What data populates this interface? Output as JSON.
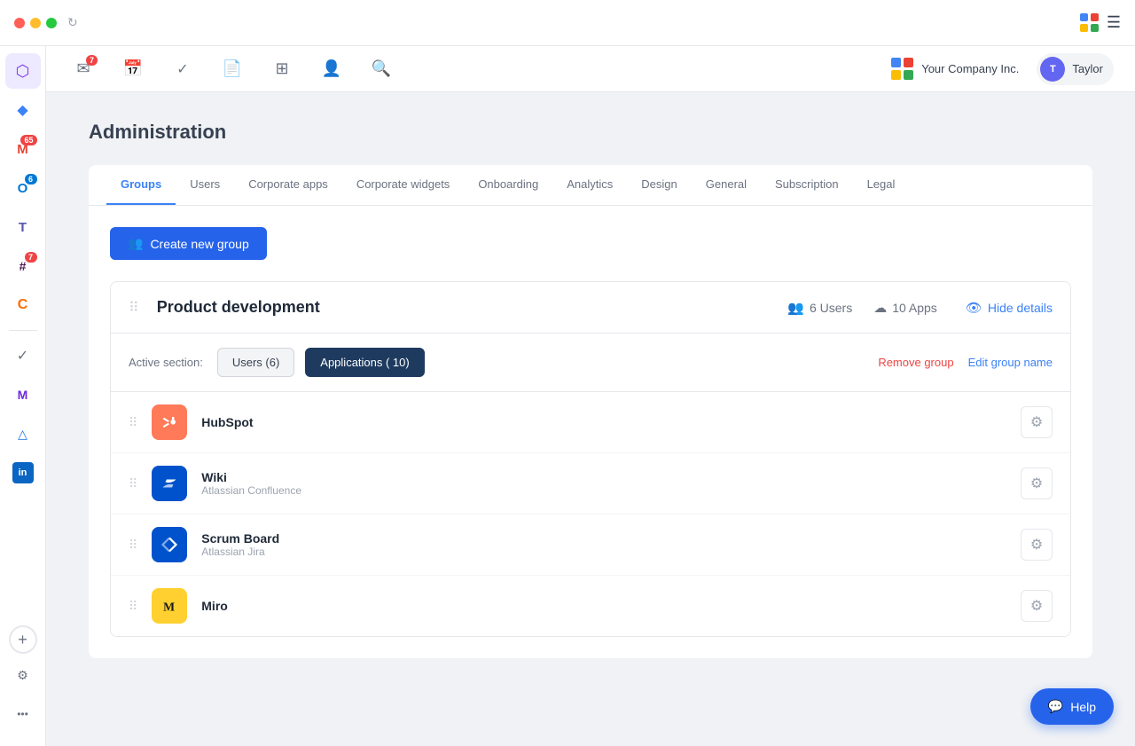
{
  "window": {
    "title": "Administration"
  },
  "topbar": {
    "company_name": "Your Company Inc.",
    "user_name": "Taylor",
    "menu_icon": "☰"
  },
  "topnav": {
    "icons": [
      {
        "name": "inbox-icon",
        "symbol": "✉",
        "badge": "7"
      },
      {
        "name": "calendar-icon",
        "symbol": "📅",
        "badge": null
      },
      {
        "name": "tasks-icon",
        "symbol": "✓",
        "badge": null
      },
      {
        "name": "document-icon",
        "symbol": "📄",
        "badge": null
      },
      {
        "name": "grid-icon",
        "symbol": "⊞",
        "badge": null
      },
      {
        "name": "person-icon",
        "symbol": "👤",
        "badge": null
      },
      {
        "name": "search-icon",
        "symbol": "🔍",
        "badge": null
      }
    ]
  },
  "sidebar": {
    "icons": [
      {
        "name": "home-icon",
        "symbol": "⬡",
        "badge": null,
        "active": true
      },
      {
        "name": "apps-icon",
        "symbol": "🔷",
        "badge": null
      },
      {
        "name": "mail-icon",
        "symbol": "M",
        "badge": "65",
        "color": "#ea4335"
      },
      {
        "name": "outlook-icon",
        "symbol": "O",
        "badge": "6",
        "color": "#0078d4"
      },
      {
        "name": "teams-icon",
        "symbol": "T",
        "badge": null,
        "color": "#5558af"
      },
      {
        "name": "slack-icon",
        "symbol": "#",
        "badge": "7",
        "color": "#4a154b"
      },
      {
        "name": "clickup-icon",
        "symbol": "C",
        "badge": null,
        "color": "#ff6b00"
      },
      {
        "name": "check-icon",
        "symbol": "✓",
        "badge": null
      },
      {
        "name": "make-icon",
        "symbol": "M",
        "badge": null,
        "color": "#6c2bd9"
      },
      {
        "name": "drive-icon",
        "symbol": "△",
        "badge": null,
        "color": "#1a73e8"
      },
      {
        "name": "linkedin-icon",
        "symbol": "in",
        "badge": null,
        "color": "#0a66c2"
      }
    ]
  },
  "page": {
    "title": "Administration",
    "tabs": [
      {
        "label": "Groups",
        "active": true
      },
      {
        "label": "Users",
        "active": false
      },
      {
        "label": "Corporate apps",
        "active": false
      },
      {
        "label": "Corporate widgets",
        "active": false
      },
      {
        "label": "Onboarding",
        "active": false
      },
      {
        "label": "Analytics",
        "active": false
      },
      {
        "label": "Design",
        "active": false
      },
      {
        "label": "General",
        "active": false
      },
      {
        "label": "Subscription",
        "active": false
      },
      {
        "label": "Legal",
        "active": false
      }
    ]
  },
  "create_btn": {
    "label": "Create new group"
  },
  "group": {
    "name": "Product development",
    "users_count": "6 Users",
    "apps_count": "10 Apps",
    "hide_details_label": "Hide details",
    "active_section_label": "Active section:",
    "users_tab": "Users (6)",
    "apps_tab": "Applications ( 10)",
    "remove_label": "Remove group",
    "edit_label": "Edit group name",
    "apps": [
      {
        "name": "HubSpot",
        "subtitle": "",
        "icon_type": "hubspot"
      },
      {
        "name": "Wiki",
        "subtitle": "Atlassian Confluence",
        "icon_type": "confluence"
      },
      {
        "name": "Scrum Board",
        "subtitle": "Atlassian Jira",
        "icon_type": "jira"
      },
      {
        "name": "Miro",
        "subtitle": "",
        "icon_type": "miro"
      }
    ]
  },
  "help_btn": {
    "label": "Help"
  }
}
